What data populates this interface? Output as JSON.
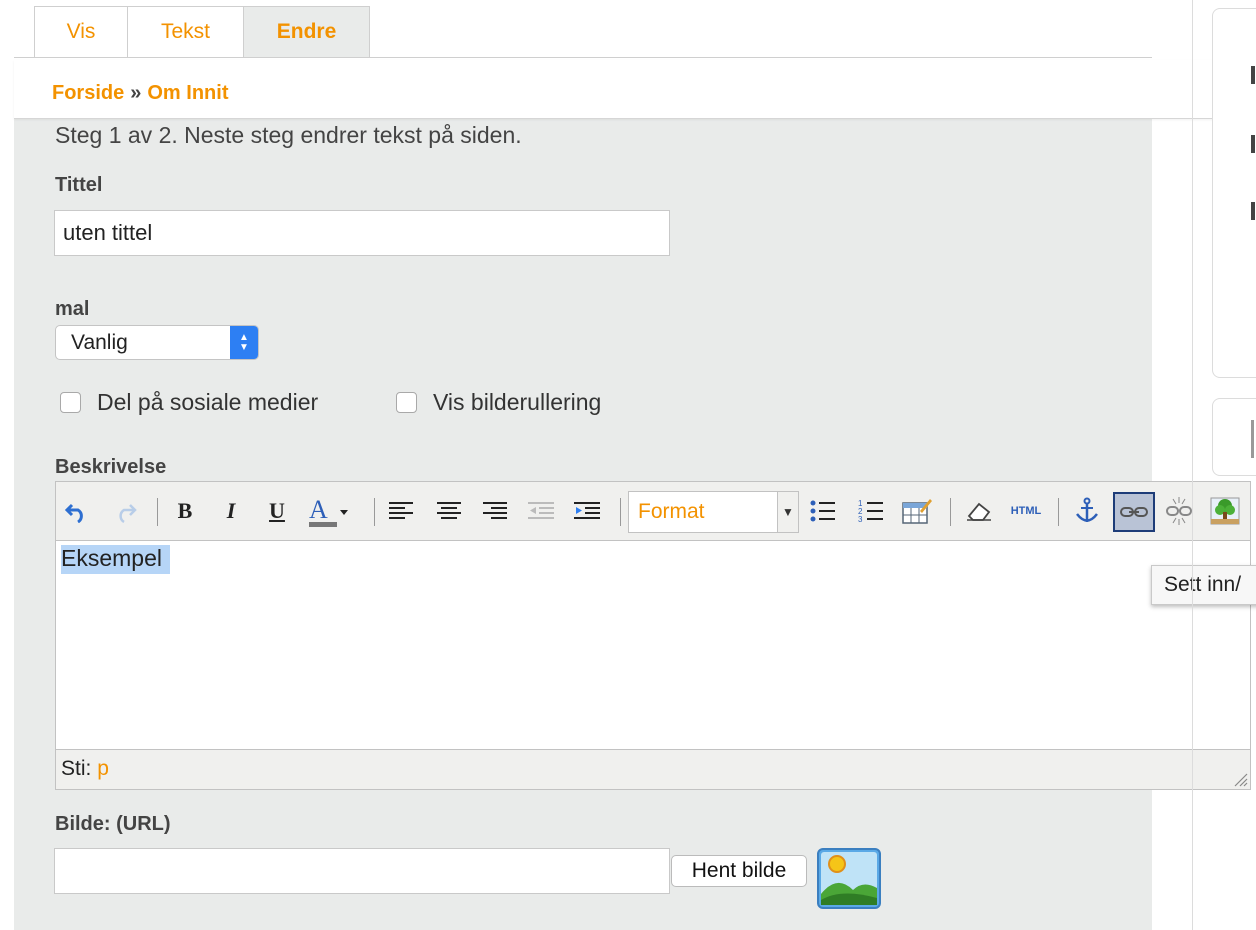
{
  "tabs": [
    {
      "label": "Vis"
    },
    {
      "label": "Tekst"
    },
    {
      "label": "Endre",
      "active": true
    }
  ],
  "breadcrumb": {
    "home": "Forside",
    "separator": "»",
    "current": "Om Innit"
  },
  "form": {
    "step_text": "Steg 1 av 2. Neste steg endrer tekst på siden.",
    "title_label": "Tittel",
    "title_value": "uten tittel",
    "template_label": "mal",
    "template_value": "Vanlig",
    "checkbox_social": "Del på sosiale medier",
    "checkbox_slideshow": "Vis bilderullering",
    "description_label": "Beskrivelse",
    "image_label": "Bilde: (URL)",
    "image_value": "",
    "fetch_button": "Hent bilde"
  },
  "editor": {
    "format_label": "Format",
    "content_text": "Eksempel",
    "path_label": "Sti:",
    "path_value": "p",
    "tooltip": "Sett inn/",
    "toolbar_icons": [
      "undo-icon",
      "redo-icon",
      "bold-icon",
      "italic-icon",
      "underline-icon",
      "font-color-icon",
      "align-left-icon",
      "align-center-icon",
      "align-right-icon",
      "outdent-icon",
      "indent-icon",
      "bullet-list-icon",
      "numbered-list-icon",
      "table-icon",
      "eraser-icon",
      "html-icon",
      "anchor-icon",
      "link-icon",
      "unlink-icon",
      "image-icon"
    ],
    "html_icon_text": "HTML"
  },
  "colors": {
    "accent": "#f39200",
    "panel": "#e9ebea",
    "selection": "#b6d5f7"
  }
}
